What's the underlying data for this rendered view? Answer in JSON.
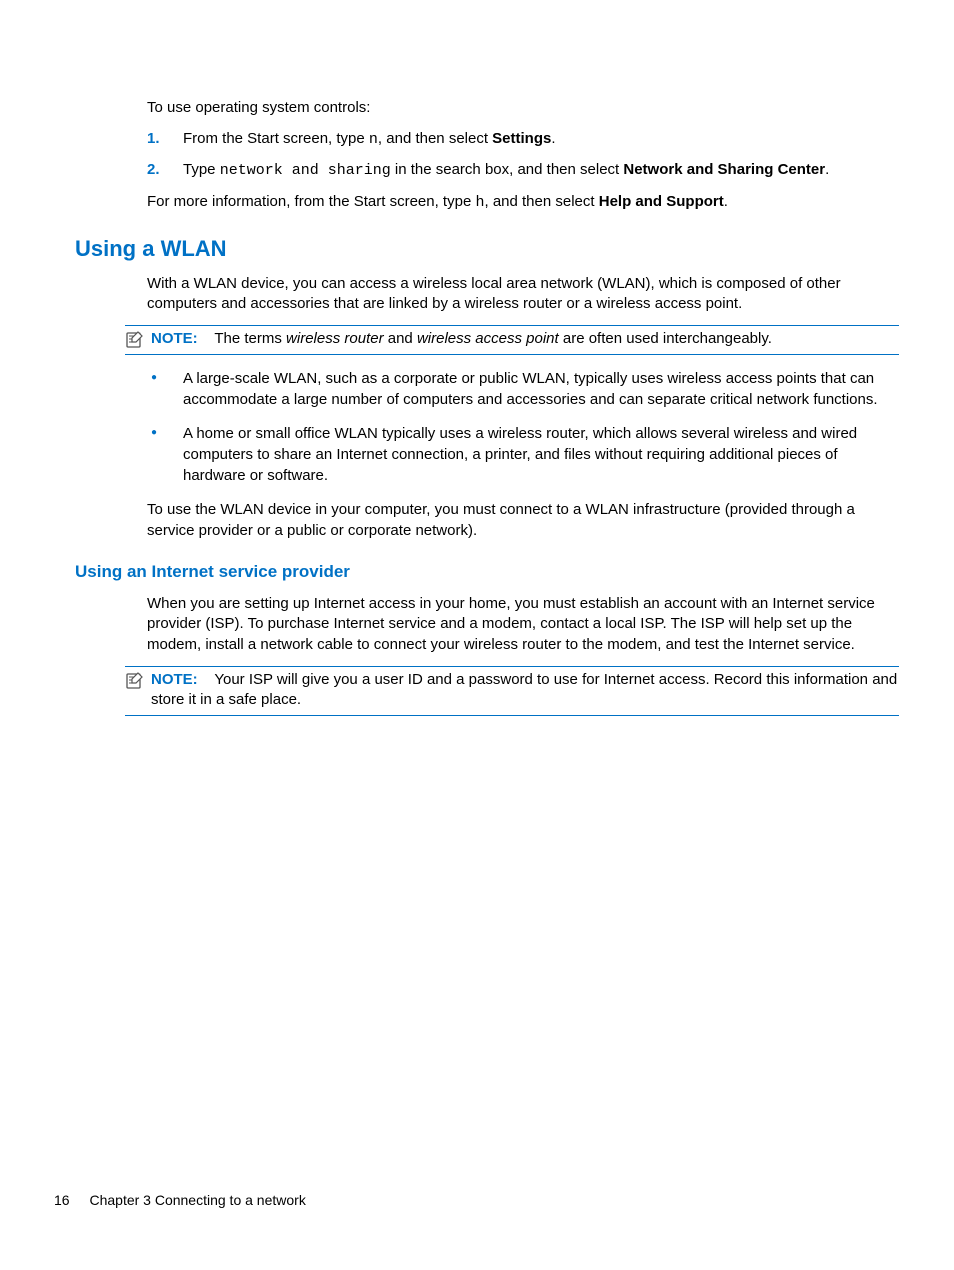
{
  "intro": {
    "lead": "To use operating system controls:",
    "steps": [
      {
        "num": "1.",
        "pre": "From the Start screen, type ",
        "code": "n",
        "mid": ", and then select ",
        "bold": "Settings",
        "post": "."
      },
      {
        "num": "2.",
        "pre": "Type ",
        "code": "network and sharing",
        "mid": " in the search box, and then select ",
        "bold": "Network and Sharing Center",
        "post": "."
      }
    ],
    "more_pre": "For more information, from the Start screen, type ",
    "more_code": "h",
    "more_mid": ", and then select ",
    "more_bold": "Help and Support",
    "more_post": "."
  },
  "wlan": {
    "heading": "Using a WLAN",
    "p1": "With a WLAN device, you can access a wireless local area network (WLAN), which is composed of other computers and accessories that are linked by a wireless router or a wireless access point.",
    "note": {
      "label": "NOTE:",
      "pre": "The terms ",
      "i1": "wireless router",
      "mid": " and ",
      "i2": "wireless access point",
      "post": " are often used interchangeably."
    },
    "bullets": [
      "A large-scale WLAN, such as a corporate or public WLAN, typically uses wireless access points that can accommodate a large number of computers and accessories and can separate critical network functions.",
      "A home or small office WLAN typically uses a wireless router, which allows several wireless and wired computers to share an Internet connection, a printer, and files without requiring additional pieces of hardware or software."
    ],
    "p2": "To use the WLAN device in your computer, you must connect to a WLAN infrastructure (provided through a service provider or a public or corporate network)."
  },
  "isp": {
    "heading": "Using an Internet service provider",
    "p1": "When you are setting up Internet access in your home, you must establish an account with an Internet service provider (ISP). To purchase Internet service and a modem, contact a local ISP. The ISP will help set up the modem, install a network cable to connect your wireless router to the modem, and test the Internet service.",
    "note": {
      "label": "NOTE:",
      "text": "Your ISP will give you a user ID and a password to use for Internet access. Record this information and store it in a safe place."
    }
  },
  "footer": {
    "page": "16",
    "chapter": "Chapter 3   Connecting to a network"
  }
}
